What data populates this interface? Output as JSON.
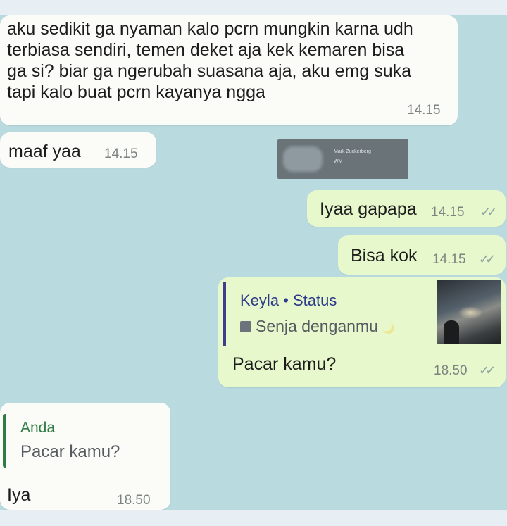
{
  "messages": {
    "m1": {
      "text_lines": [
        "aku sedikit ga nyaman kalo pcrn mungkin karna udh",
        "terbiasa sendiri, temen deket aja kek kemaren bisa",
        "ga si? biar ga ngerubah suasana aja, aku emg suka",
        "tapi kalo buat pcrn kayanya ngga"
      ],
      "time": "14.15"
    },
    "m2": {
      "text": "maaf yaa",
      "time": "14.15"
    },
    "m3": {
      "text": "Iyaa gapapa",
      "time": "14.15",
      "ticks": "✓✓"
    },
    "m4": {
      "text": "Bisa kok",
      "time": "14.15",
      "ticks": "✓✓"
    },
    "m5": {
      "quote_author": "Keyla • Status",
      "quote_text": "Senja denganmu",
      "quote_emoji": "🌙",
      "text": "Pacar kamu?",
      "time": "18.50",
      "ticks": "✓✓"
    },
    "m6": {
      "quote_author": "Anda",
      "quote_text": "Pacar kamu?",
      "text": "Iya",
      "time": "18.50"
    }
  },
  "watermark": {
    "name": "Mark Zuckerberg",
    "sub": "WM"
  },
  "colors": {
    "chat_background": "#b9dbe0",
    "incoming_bubble": "#fbfbf7",
    "outgoing_bubble": "#e6f8cc",
    "status_quote_bar": "#3b3f8c",
    "reply_quote_bar": "#2f7d45"
  }
}
